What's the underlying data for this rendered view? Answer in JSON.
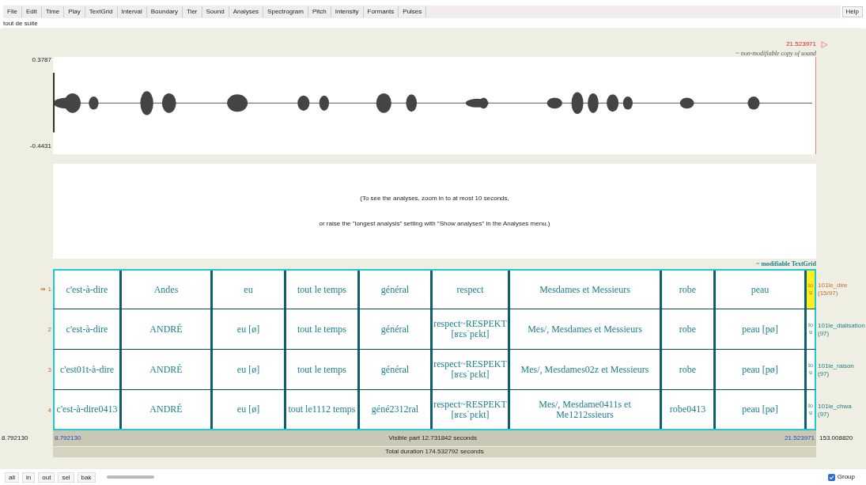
{
  "menu": [
    "File",
    "Edit",
    "Time",
    "Play",
    "TextGrid",
    "Interval",
    "Boundary",
    "Tier",
    "Sound",
    "Analyses",
    "Spectrogram",
    "Pitch",
    "Intensity",
    "Formants",
    "Pulses"
  ],
  "help": "Help",
  "text_field": {
    "value": "tout de suite"
  },
  "sound": {
    "max": "0.3787",
    "min": "-0.4431",
    "cursor_time": "21.523971",
    "label": "~ non-modifiable copy of sound"
  },
  "analysis_message": [
    "(To see the analyses, zoom in to at most 10 seconds,",
    "or raise the \"longest analysis\" setting with \"Show analyses\" in the Analyses menu.)"
  ],
  "textgrid_label": "~ modifiable TextGrid",
  "tiers": [
    {
      "number": "1",
      "marker": "⇛",
      "selected": true,
      "name": "101le_dire",
      "count": "(15/97)",
      "intervals": [
        "c'est-à-dire",
        "Andes",
        "eu",
        "tout le temps",
        "général",
        "respect",
        "Mesdames et Messieurs",
        "robe",
        "peau",
        "tou"
      ]
    },
    {
      "number": "2",
      "selected": false,
      "name": "101le_dialisation",
      "count": "(97)",
      "intervals": [
        "c'est-à-dire",
        "ANDRÉ",
        "eu [ø]",
        "tout le temps",
        "général",
        "respect~RESPEKT [ʁɛsˈpɛkt]",
        "Mes/, Mesdames et Messieurs",
        "robe",
        "peau [pø]",
        "tou"
      ]
    },
    {
      "number": "3",
      "selected": false,
      "name": "101le_raison",
      "count": "(97)",
      "intervals": [
        "c'est01t-à-dire",
        "ANDRÉ",
        "eu [ø]",
        "tout le temps",
        "général",
        "respect~RESPEKT [ʁɛsˈpɛkt]",
        "Mes/, Mesdames02z et Messieurs",
        "robe",
        "peau [pø]",
        "tou"
      ]
    },
    {
      "number": "4",
      "selected": false,
      "name": "101le_chwa",
      "count": "(97)",
      "intervals": [
        "c'est-à-dire0413",
        "ANDRÉ",
        "eu [ø]",
        "tout le1112 temps",
        "géné2312ral",
        "respect~RESPEKT [ʁɛsˈpɛkt]",
        "Mes/, Mesdame0411s et Me1212ssieurs",
        "robe0413",
        "peau [pø]",
        "tou"
      ]
    }
  ],
  "time_bar": {
    "window_start": "8.792130",
    "start": "8.792130",
    "visible": "Visible part 12.731842 seconds",
    "end": "21.523971",
    "window_end": "153.008820",
    "total": "Total duration 174.532792 seconds"
  },
  "buttons": [
    "all",
    "in",
    "out",
    "sel",
    "bak"
  ],
  "group": {
    "label": "Group",
    "checked": true
  }
}
